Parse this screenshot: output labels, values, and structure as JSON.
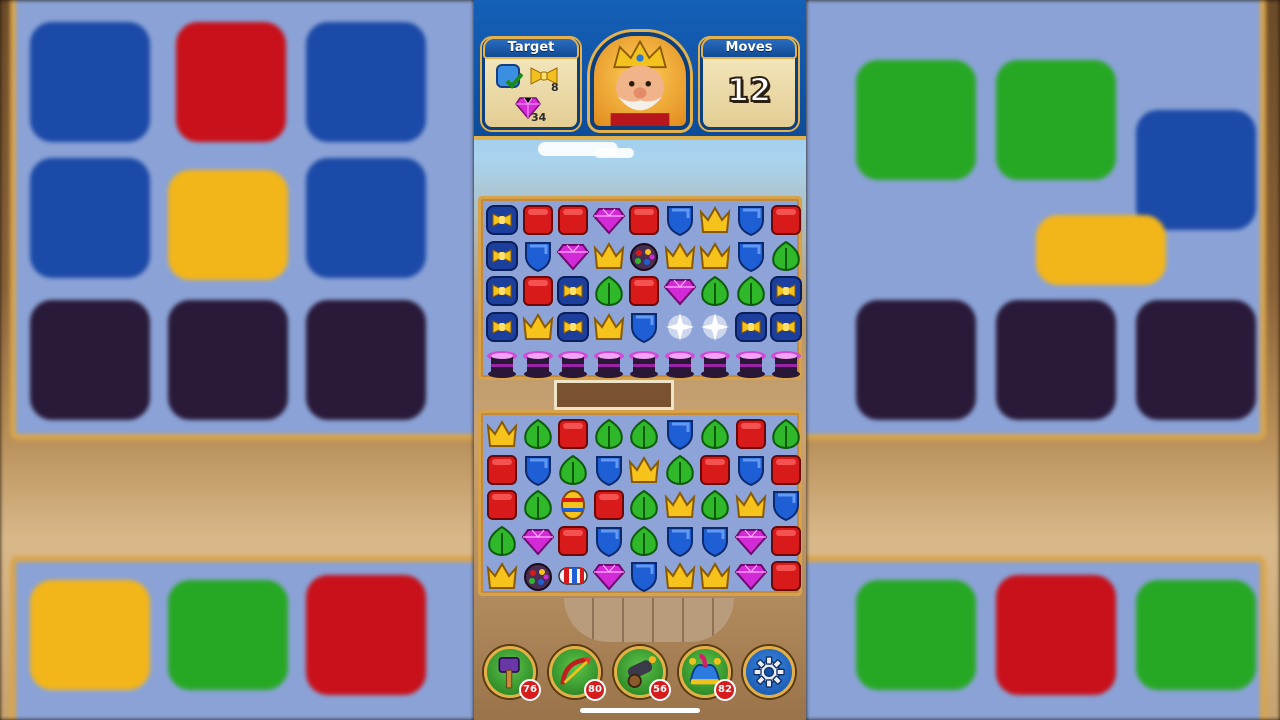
{
  "hud": {
    "target_title": "Target",
    "moves_title": "Moves",
    "moves_value": "12",
    "targets": [
      {
        "icon": "blue-tile-check-icon",
        "count": ""
      },
      {
        "icon": "golden-bow-icon",
        "count": "8"
      },
      {
        "icon": "purple-gem-icon",
        "count": "34"
      }
    ]
  },
  "avatar": {
    "icon": "king-avatar-icon"
  },
  "colors": {
    "red": "#d91a1a",
    "blue": "#1f5fd6",
    "green": "#2fb82a",
    "yellow": "#f6c21c",
    "purple": "#d22ad6",
    "board": "#8ea4d8",
    "frame": "#d7a24a"
  },
  "board_top": [
    [
      "box",
      "red",
      "red",
      "gem",
      "red",
      "shield",
      "crown",
      "shield",
      "red"
    ],
    [
      "box",
      "shield",
      "gem",
      "crown",
      "bomb",
      "crown",
      "crown",
      "shield",
      "leaf"
    ],
    [
      "box",
      "red",
      "box",
      "leaf",
      "red",
      "gem",
      "leaf",
      "leaf",
      "box"
    ],
    [
      "box",
      "crown",
      "box",
      "crown",
      "shield",
      "sparkle",
      "sparkle",
      "box",
      "box"
    ],
    [
      "hat",
      "hat",
      "hat",
      "hat",
      "hat",
      "hat",
      "hat",
      "hat",
      "hat"
    ]
  ],
  "board_bottom": [
    [
      "crown",
      "leaf",
      "red",
      "leaf",
      "leaf",
      "shield",
      "leaf",
      "red",
      "leaf"
    ],
    [
      "red",
      "shield",
      "leaf",
      "shield",
      "crown",
      "leaf",
      "red",
      "shield",
      "red"
    ],
    [
      "red",
      "leaf",
      "egg",
      "red",
      "leaf",
      "crown",
      "leaf",
      "crown",
      "shield"
    ],
    [
      "leaf",
      "gem",
      "red",
      "shield",
      "leaf",
      "shield",
      "shield",
      "gem",
      "red"
    ],
    [
      "crown",
      "bomb",
      "rocket",
      "gem",
      "shield",
      "crown",
      "crown",
      "gem",
      "red"
    ]
  ],
  "boosters": [
    {
      "icon": "hammer-booster-icon",
      "count": "76"
    },
    {
      "icon": "arrow-booster-icon",
      "count": "80"
    },
    {
      "icon": "cannon-booster-icon",
      "count": "56"
    },
    {
      "icon": "jester-hat-booster-icon",
      "count": "82"
    }
  ],
  "settings": {
    "icon": "gear-icon"
  }
}
